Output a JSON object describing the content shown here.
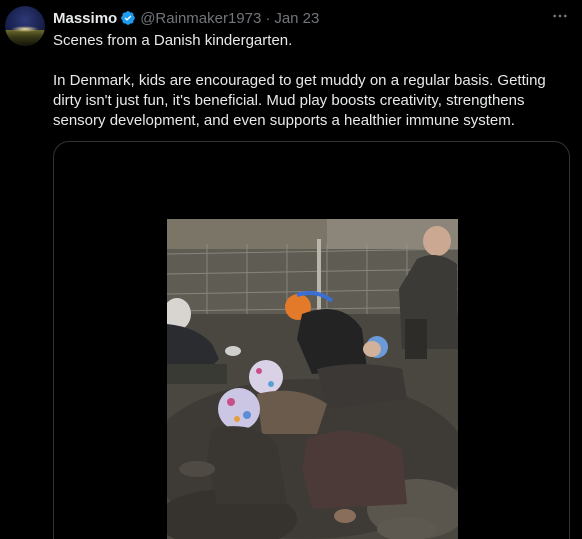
{
  "tweet": {
    "author_name": "Massimo",
    "handle": "@Rainmaker1973",
    "separator": "·",
    "date": "Jan 23",
    "paragraphs": [
      "Scenes from a Danish kindergarten.",
      "In Denmark, kids are encouraged to get muddy on a regular basis. Getting dirty isn't just fun, it's beneficial. Mud play boosts creativity, strengthens sensory development, and even supports a healthier immune system."
    ]
  },
  "icons": {
    "verified": "verified-badge-icon",
    "more": "more-horizontal-icon"
  },
  "colors": {
    "background": "#000000",
    "text": "#e7e9ea",
    "secondary": "#71767b",
    "verified": "#1d9bf0",
    "border": "#2f3336"
  }
}
